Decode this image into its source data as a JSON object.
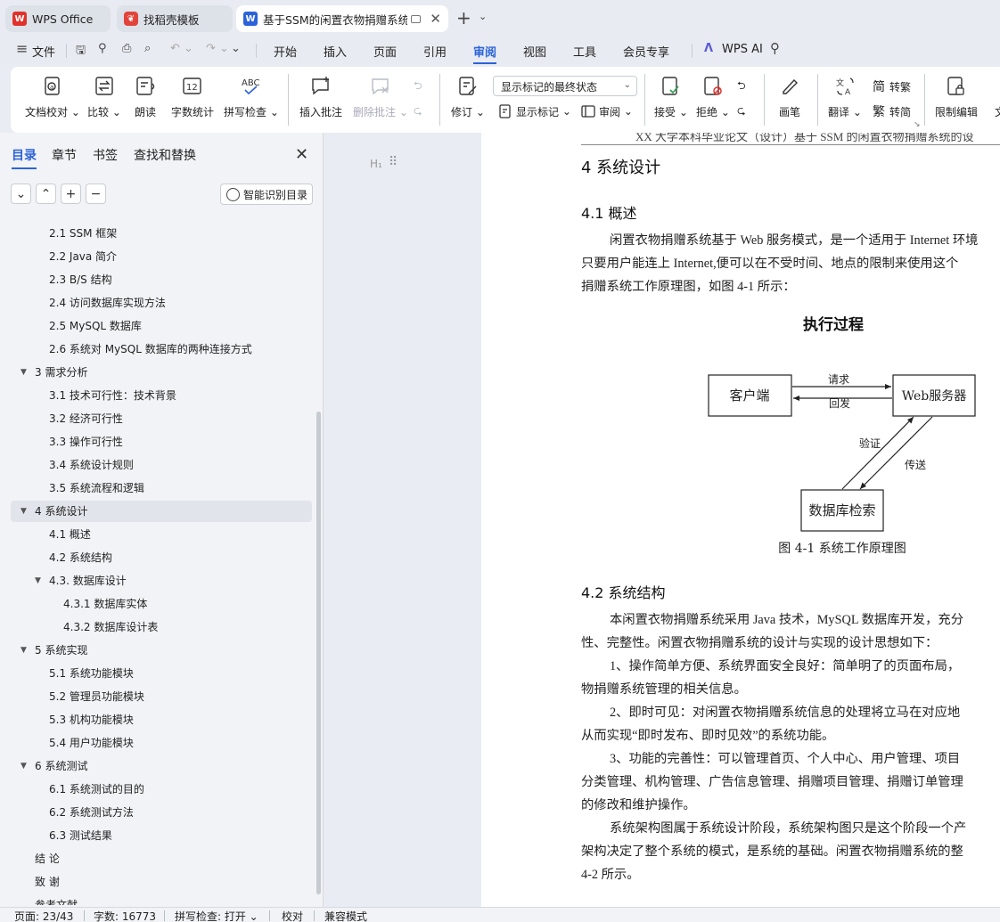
{
  "tabs": [
    {
      "label": "WPS Office",
      "icon": "wps-logo-icon"
    },
    {
      "label": "找稻壳模板",
      "icon": "docer-template-icon"
    },
    {
      "label": "基于SSM的闲置衣物捐赠系统",
      "icon": "word-doc-icon",
      "active": true
    }
  ],
  "menu": {
    "file_label": "文件",
    "items": [
      "开始",
      "插入",
      "页面",
      "引用",
      "审阅",
      "视图",
      "工具",
      "会员专享"
    ],
    "active_item": "审阅",
    "wps_ai_label": "WPS AI"
  },
  "ribbon": {
    "doc_check": "文档校对",
    "compare": "比较",
    "read_aloud": "朗读",
    "word_count": "字数统计",
    "spell_check": "拼写检查",
    "insert_comment": "插入批注",
    "delete_comment": "删除批注",
    "revise": "修订",
    "markup_mode": "显示标记的最终状态",
    "show_markup": "显示标记",
    "review": "审阅",
    "accept": "接受",
    "reject": "拒绝",
    "pen": "画笔",
    "translate": "翻译",
    "to_traditional": "转繁",
    "to_simplified": "转简",
    "restrict_edit": "限制编辑",
    "more_partial": "文"
  },
  "sidebar": {
    "tabs": [
      "目录",
      "章节",
      "书签",
      "查找和替换"
    ],
    "active_tab": "目录",
    "smart_toc_label": "智能识别目录",
    "toc": [
      {
        "label": "2.1 SSM 框架",
        "level": 2
      },
      {
        "label": "2.2 Java 简介",
        "level": 2
      },
      {
        "label": "2.3 B/S 结构",
        "level": 2
      },
      {
        "label": "2.4 访问数据库实现方法",
        "level": 2
      },
      {
        "label": "2.5 MySQL 数据库",
        "level": 2
      },
      {
        "label": "2.6 系统对 MySQL 数据库的两种连接方式",
        "level": 2
      },
      {
        "label": "3  需求分析",
        "level": 1,
        "expanded": true
      },
      {
        "label": "3.1 技术可行性：技术背景",
        "level": 2
      },
      {
        "label": "3.2 经济可行性",
        "level": 2
      },
      {
        "label": "3.3 操作可行性",
        "level": 2
      },
      {
        "label": "3.4 系统设计规则",
        "level": 2
      },
      {
        "label": "3.5 系统流程和逻辑",
        "level": 2
      },
      {
        "label": "4  系统设计",
        "level": 1,
        "expanded": true,
        "selected": true
      },
      {
        "label": "4.1  概述",
        "level": 2
      },
      {
        "label": "4.2  系统结构",
        "level": 2
      },
      {
        "label": "4.3.  数据库设计",
        "level": 2,
        "expanded": true
      },
      {
        "label": "4.3.1  数据库实体",
        "level": 3
      },
      {
        "label": "4.3.2  数据库设计表",
        "level": 3
      },
      {
        "label": "5  系统实现",
        "level": 1,
        "expanded": true
      },
      {
        "label": "5.1 系统功能模块",
        "level": 2
      },
      {
        "label": "5.2 管理员功能模块",
        "level": 2
      },
      {
        "label": "5.3 机构功能模块",
        "level": 2
      },
      {
        "label": "5.4 用户功能模块",
        "level": 2
      },
      {
        "label": "6  系统测试",
        "level": 1,
        "expanded": true
      },
      {
        "label": "6.1 系统测试的目的",
        "level": 2
      },
      {
        "label": "6.2 系统测试方法",
        "level": 2
      },
      {
        "label": "6.3  测试结果",
        "level": 2
      },
      {
        "label": "结   论",
        "level": 1
      },
      {
        "label": "致   谢",
        "level": 1
      },
      {
        "label": "参考文献",
        "level": 1
      }
    ]
  },
  "document": {
    "running_head": "XX 大学本科毕业论文（设计）基于 SSM 的闲置衣物捐赠系统的设",
    "heading_marker": "H₁",
    "h1": "4  系统设计",
    "h2_1": "4.1  概述",
    "p1_lines": [
      "闲置衣物捐赠系统基于 Web 服务模式，是一个适用于 Internet 环境",
      "只要用户能连上 Internet,便可以在不受时间、地点的限制来使用这个",
      "捐赠系统工作原理图，如图 4-1 所示："
    ],
    "diagram": {
      "title": "执行过程",
      "client": "客户端",
      "web_server": "Web服务器",
      "db": "数据库检索",
      "request": "请求",
      "reply": "回发",
      "verify": "验证",
      "transfer": "传送",
      "caption": "图 4-1 系统工作原理图"
    },
    "h2_2": "4.2  系统结构",
    "p2_lines": [
      "本闲置衣物捐赠系统采用 Java 技术，MySQL 数据库开发，充分",
      "性、完整性。闲置衣物捐赠系统的设计与实现的设计思想如下：",
      "1、操作简单方便、系统界面安全良好：简单明了的页面布局，",
      "物捐赠系统管理的相关信息。",
      "2、即时可见：对闲置衣物捐赠系统信息的处理将立马在对应地",
      "从而实现“即时发布、即时见效”的系统功能。",
      "3、功能的完善性：可以管理首页、个人中心、用户管理、项目",
      "分类管理、机构管理、广告信息管理、捐赠项目管理、捐赠订单管理",
      "的修改和维护操作。",
      "系统架构图属于系统设计阶段，系统架构图只是这个阶段一个产",
      "架构决定了整个系统的模式，是系统的基础。闲置衣物捐赠系统的整",
      "4-2 所示。"
    ]
  },
  "status": {
    "page": "页面: 23/43",
    "words": "字数: 16773",
    "spell": "拼写检查: 打开",
    "proof": "校对",
    "compat": "兼容模式"
  },
  "colors": {
    "accent": "#2b63d9",
    "wps_red": "#e0312b"
  }
}
